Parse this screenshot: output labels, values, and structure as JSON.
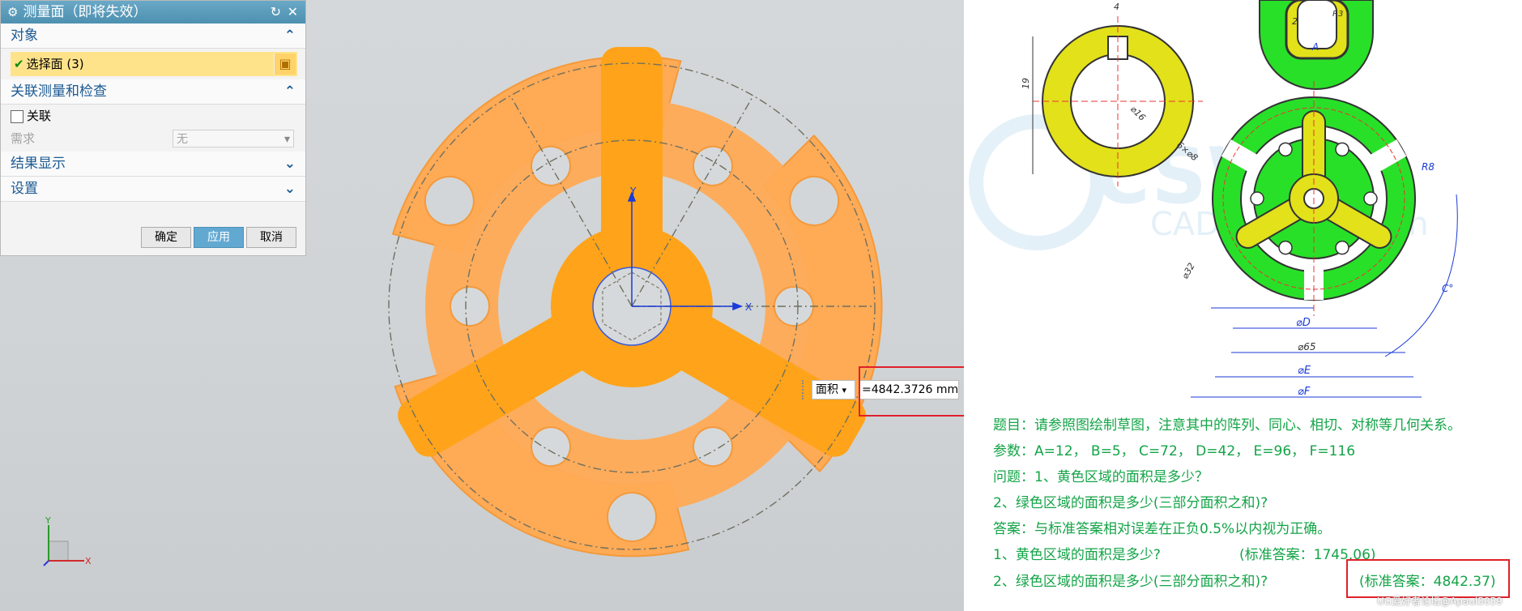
{
  "dialog": {
    "title": "测量面（即将失效）",
    "section_object": "对象",
    "select_face_label": "选择面 (3)",
    "section_assoc": "关联测量和检查",
    "assoc_checkbox_label": "关联",
    "requirement_label": "需求",
    "requirement_value": "无",
    "section_results": "结果显示",
    "section_settings": "设置",
    "ok_label": "确定",
    "apply_label": "应用",
    "cancel_label": "取消"
  },
  "measure": {
    "type_label": "面积",
    "value_text": "=4842.3726 mm"
  },
  "triad": {
    "x_label": "X",
    "y_label": "Y"
  },
  "small_triad": {
    "x_label": "X",
    "y_label": "Y"
  },
  "drawing": {
    "dim_top": "4",
    "dim_r": "R3",
    "dim_2": "2",
    "dim_A": "A",
    "dim_19": "19",
    "dim_16": "⌀16",
    "dim_6x8": "6×⌀8",
    "dim_R8": "R8",
    "dim_32": "⌀32",
    "dim_C": "C°",
    "dim_D": "⌀D",
    "dim_65": "⌀65",
    "dim_E": "⌀E",
    "dim_F": "⌀F",
    "watermark_logo": "CSWCS",
    "watermark_sub": "CAD Competition"
  },
  "doc": {
    "line1": "题目：请参照图绘制草图，注意其中的阵列、同心、相切、对称等几何关系。",
    "line2": "参数：A=12，  B=5，  C=72，  D=42，  E=96，  F=116",
    "line3": "问题：1、黄色区域的面积是多少？",
    "line4": "2、绿色区域的面积是多少(三部分面积之和)?",
    "line5": "答案：与标准答案相对误差在正负0.5%以内视为正确。",
    "line6a": "1、黄色区域的面积是多少?",
    "line6b": "(标准答案：1745.06)",
    "line7a": "2、绿色区域的面积是多少(三部分面积之和)?",
    "line7b": "(标准答案：4842.37)",
    "bottom_watermark": "UG爱好者论坛@Apaul5059"
  },
  "colors": {
    "orange_face": "#ffa94d",
    "orange_selected": "#ffa31a",
    "green": "#28e028",
    "yellow": "#e2e11a",
    "answer_text": "#13a447",
    "highlight_red": "#e0202a",
    "dialog_title": "#5a9dbe"
  },
  "icons": [
    "gear-icon",
    "reset-icon",
    "close-icon",
    "check-icon",
    "cube-icon",
    "chevron-up-icon",
    "chevron-down-icon",
    "dropdown-arrow-icon"
  ]
}
